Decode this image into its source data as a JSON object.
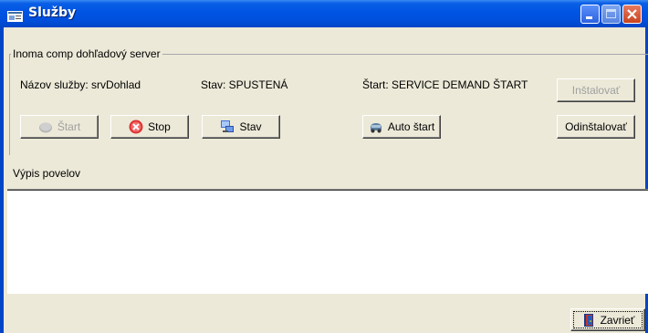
{
  "window": {
    "title": "Služby"
  },
  "group": {
    "title": "Inoma comp dohľadový server",
    "service_name": "Názov služby: srvDohlad",
    "state": "Stav: SPUSTENÁ",
    "start_type": "Štart: SERVICE DEMAND ŠTART"
  },
  "buttons": {
    "install": "Inštalovať",
    "start": "Štart",
    "stop": "Stop",
    "status": "Stav",
    "auto_start": "Auto štart",
    "uninstall": "Odinštalovať",
    "close": "Zavrieť"
  },
  "log": {
    "label": "Výpis povelov"
  },
  "icons": [
    "app-icon",
    "minimize-icon",
    "maximize-icon",
    "close-icon",
    "start-icon",
    "stop-icon",
    "status-icon",
    "auto-start-icon",
    "door-icon"
  ],
  "colors": {
    "titlebar": "#0054E3",
    "face": "#ECE9D8",
    "close": "#D8482A"
  }
}
